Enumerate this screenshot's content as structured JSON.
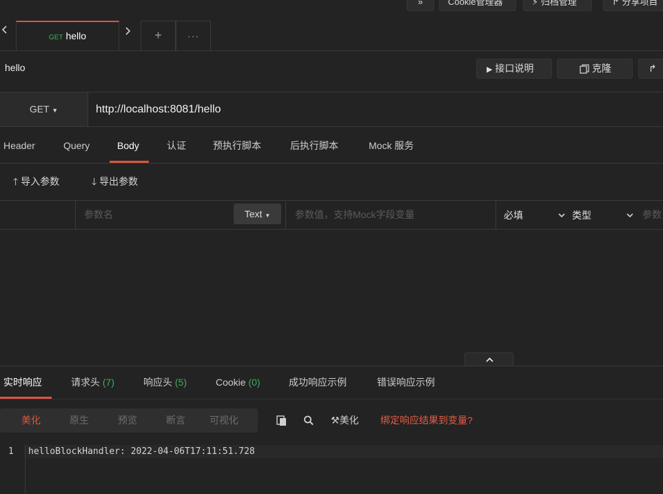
{
  "top_buttons": {
    "expand": "»",
    "cookie": "Cookie管理器",
    "archive": "归档管理",
    "share": "分享项目"
  },
  "open_tab": {
    "method": "GET",
    "name": "hello"
  },
  "doc": {
    "title": "hello",
    "api_doc": "接口说明",
    "clone": "克隆"
  },
  "request": {
    "method": "GET",
    "url": "http://localhost:8081/hello"
  },
  "request_tabs": [
    "Header",
    "Query",
    "Body",
    "认证",
    "预执行脚本",
    "后执行脚本",
    "Mock 服务"
  ],
  "body_actions": {
    "import": "导入参数",
    "export": "导出参数"
  },
  "param_row": {
    "name_placeholder": "参数名",
    "type_button": "Text",
    "value_placeholder": "参数值，支持Mock字段变量",
    "required": "必填",
    "type": "类型",
    "desc_placeholder": "参数"
  },
  "response_tabs": [
    {
      "label": "实时响应",
      "count": ""
    },
    {
      "label": "请求头",
      "count": "(7)"
    },
    {
      "label": "响应头",
      "count": "(5)"
    },
    {
      "label": "Cookie",
      "count": "(0)"
    },
    {
      "label": "成功响应示例",
      "count": ""
    },
    {
      "label": "错误响应示例",
      "count": ""
    }
  ],
  "view_modes": [
    "美化",
    "原生",
    "预览",
    "断言",
    "可视化"
  ],
  "toolbar": {
    "beautify": "美化",
    "bind": "绑定响应结果到变量?"
  },
  "response_body": {
    "line_number": "1",
    "text": "helloBlockHandler: 2022-04-06T17:11:51.728"
  },
  "colors": {
    "accent": "#e0533f",
    "count_green": "#3fae5c",
    "background": "#232323"
  }
}
